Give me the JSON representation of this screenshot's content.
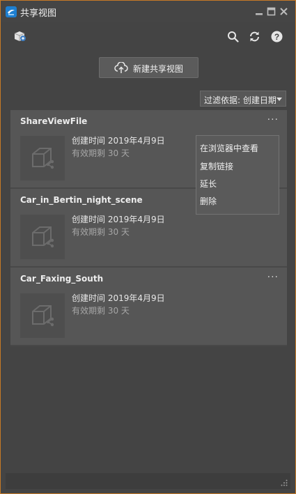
{
  "window": {
    "title": "共享视图",
    "accent": "#c77a26"
  },
  "titlebar": {
    "app_icon": "app-logo-icon",
    "controls": [
      "minimize-icon",
      "maximize-icon",
      "close-icon"
    ]
  },
  "toolbar": {
    "cube_icon": "share-cube-icon",
    "search_icon": "search-icon",
    "refresh_icon": "refresh-icon",
    "help_icon": "help-icon"
  },
  "new_view_button": {
    "label": "新建共享视图",
    "icon": "cloud-upload-icon"
  },
  "filter": {
    "label": "过滤依据: 创建日期"
  },
  "cards": [
    {
      "title": "ShareViewFile",
      "more": "···",
      "date": "创建时间 2019年4月9日",
      "expiry": "有效期剩 30 天"
    },
    {
      "title": "Car_in_Bertin_night_scene",
      "more": "",
      "date": "创建时间 2019年4月9日",
      "expiry": "有效期剩 30 天"
    },
    {
      "title": "Car_Faxing_South",
      "more": "···",
      "date": "创建时间 2019年4月9日",
      "expiry": "有效期剩 30 天"
    }
  ],
  "context_menu": {
    "items": [
      "在浏览器中查看",
      "复制链接",
      "延长",
      "删除"
    ]
  }
}
